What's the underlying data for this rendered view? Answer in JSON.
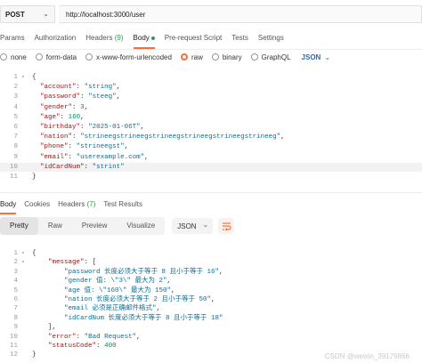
{
  "request": {
    "method": "POST",
    "url": "http://localhost:3000/user"
  },
  "request_tabs": [
    {
      "label": "Params"
    },
    {
      "label": "Authorization"
    },
    {
      "label": "Headers",
      "count": "(9)"
    },
    {
      "label": "Body",
      "active": true
    },
    {
      "label": "Pre-request Script"
    },
    {
      "label": "Tests"
    },
    {
      "label": "Settings"
    }
  ],
  "body_types": [
    {
      "label": "none",
      "selected": false
    },
    {
      "label": "form-data",
      "selected": false
    },
    {
      "label": "x-www-form-urlencoded",
      "selected": false
    },
    {
      "label": "raw",
      "selected": true
    },
    {
      "label": "binary",
      "selected": false
    },
    {
      "label": "GraphQL",
      "selected": false
    }
  ],
  "body_format": "JSON",
  "request_body_lines": [
    {
      "num": "1",
      "text": "{"
    },
    {
      "num": "2",
      "text": "  \"account\": \"string\","
    },
    {
      "num": "3",
      "text": "  \"password\": \"steeg\","
    },
    {
      "num": "4",
      "text": "  \"gender\": 3,"
    },
    {
      "num": "5",
      "text": "  \"age\": 160,"
    },
    {
      "num": "6",
      "text": "  \"birthday\": \"2025-01-06T\","
    },
    {
      "num": "7",
      "text": "  \"nation\": \"strineegstrineegstrineegstrineegstrineegstrineeg\","
    },
    {
      "num": "8",
      "text": "  \"phone\": \"strineegst\","
    },
    {
      "num": "9",
      "text": "  \"email\": \"userexample.com\","
    },
    {
      "num": "10",
      "text": "  \"idCardNum\": \"strint\""
    },
    {
      "num": "11",
      "text": "}"
    }
  ],
  "response_tabs": [
    {
      "label": "Body",
      "active": true
    },
    {
      "label": "Cookies"
    },
    {
      "label": "Headers",
      "count": "(7)"
    },
    {
      "label": "Test Results"
    }
  ],
  "view_modes": [
    {
      "label": "Pretty",
      "active": true
    },
    {
      "label": "Raw"
    },
    {
      "label": "Preview"
    },
    {
      "label": "Visualize"
    }
  ],
  "response_format": "JSON",
  "response_body_lines": [
    {
      "num": "1",
      "text": "{"
    },
    {
      "num": "2",
      "text": "    \"message\": ["
    },
    {
      "num": "3",
      "text": "        \"password 长度必须大于等于 8 且小于等于 16\","
    },
    {
      "num": "4",
      "text": "        \"gender 值: \\\"3\\\" 最大为 2\","
    },
    {
      "num": "5",
      "text": "        \"age 值: \\\"160\\\" 最大为 150\","
    },
    {
      "num": "6",
      "text": "        \"nation 长度必须大于等于 2 且小于等于 50\","
    },
    {
      "num": "7",
      "text": "        \"email 必须是正确邮件格式\","
    },
    {
      "num": "8",
      "text": "        \"idCardNum 长度必须大于等于 8 且小于等于 18\""
    },
    {
      "num": "9",
      "text": "    ],"
    },
    {
      "num": "10",
      "text": "    \"error\": \"Bad Request\","
    },
    {
      "num": "11",
      "text": "    \"statusCode\": 400"
    },
    {
      "num": "12",
      "text": "}"
    }
  ],
  "watermark": "CSDN @weixin_39179866",
  "colors": {
    "accent": "#ff6c37",
    "key": "#a31515",
    "string": "#0b6e99",
    "number": "#098658",
    "count_green": "#2a9d4a"
  }
}
